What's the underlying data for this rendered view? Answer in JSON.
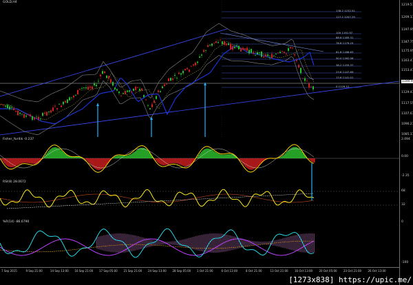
{
  "chart": {
    "symbol_label": "GOLD,H4",
    "panels": [
      {
        "id": "price",
        "title": "GOLD,H4"
      },
      {
        "id": "fisher",
        "title": "Fisher_Yur4ik -0.237"
      },
      {
        "id": "rsi",
        "title": "RSI(8) 28.0672"
      },
      {
        "id": "wpr",
        "title": "%R(14) -86.6790"
      }
    ]
  },
  "price_scale": [
    "1219.57",
    "1209.17",
    "1197.95",
    "1187.75",
    "1175.95",
    "1163.47",
    "1153.47",
    "1140.93",
    "1129.43",
    "1117.55",
    "1107.67",
    "1096.27",
    "1085.17"
  ],
  "price_current": "1140.93",
  "fisher_scale": [
    "2.094",
    "0.00",
    "-2.35"
  ],
  "rsi_scale": [
    "68",
    "32"
  ],
  "wpr_scale": [
    "0",
    "-100"
  ],
  "fib_levels": [
    "138.2 1232.51",
    "127.2 1207.29",
    "100 1191.97",
    "88.6 1185.31",
    "78.6 1179.25",
    "61.8 1168.63",
    "50.0 1162.06",
    "38.2 1155.37",
    "23.6 1147.69",
    "13.6 1141.01",
    "0 1129.12"
  ],
  "time_labels": [
    "7 Sep 2015",
    "9 Sep 21:00",
    "14 Sep 13:00",
    "16 Sep 21:00",
    "17 Sep 05:00",
    "21 Sep 21:00",
    "24 Sep 13:00",
    "28 Sep 05:00",
    "1 Oct 21:00",
    "6 Oct 13:00",
    "8 Oct 21:00",
    "13 Oct 21:00",
    "16 Oct 13:00",
    "20 Oct 05:00",
    "23 Oct 21:00",
    "26 Oct 13:00"
  ],
  "watermark": "[1273x838] https://upic.me/",
  "colors": {
    "up_candle": "#22c02a",
    "down_candle": "#d21e1e",
    "band": "#3b4cff",
    "signal": "#1fb3ff",
    "fisher_line": "#ffd000",
    "rsi_line": "#ffeb1a",
    "wpr_line": "#24d9e8",
    "wpr_second": "#c040ff"
  }
}
